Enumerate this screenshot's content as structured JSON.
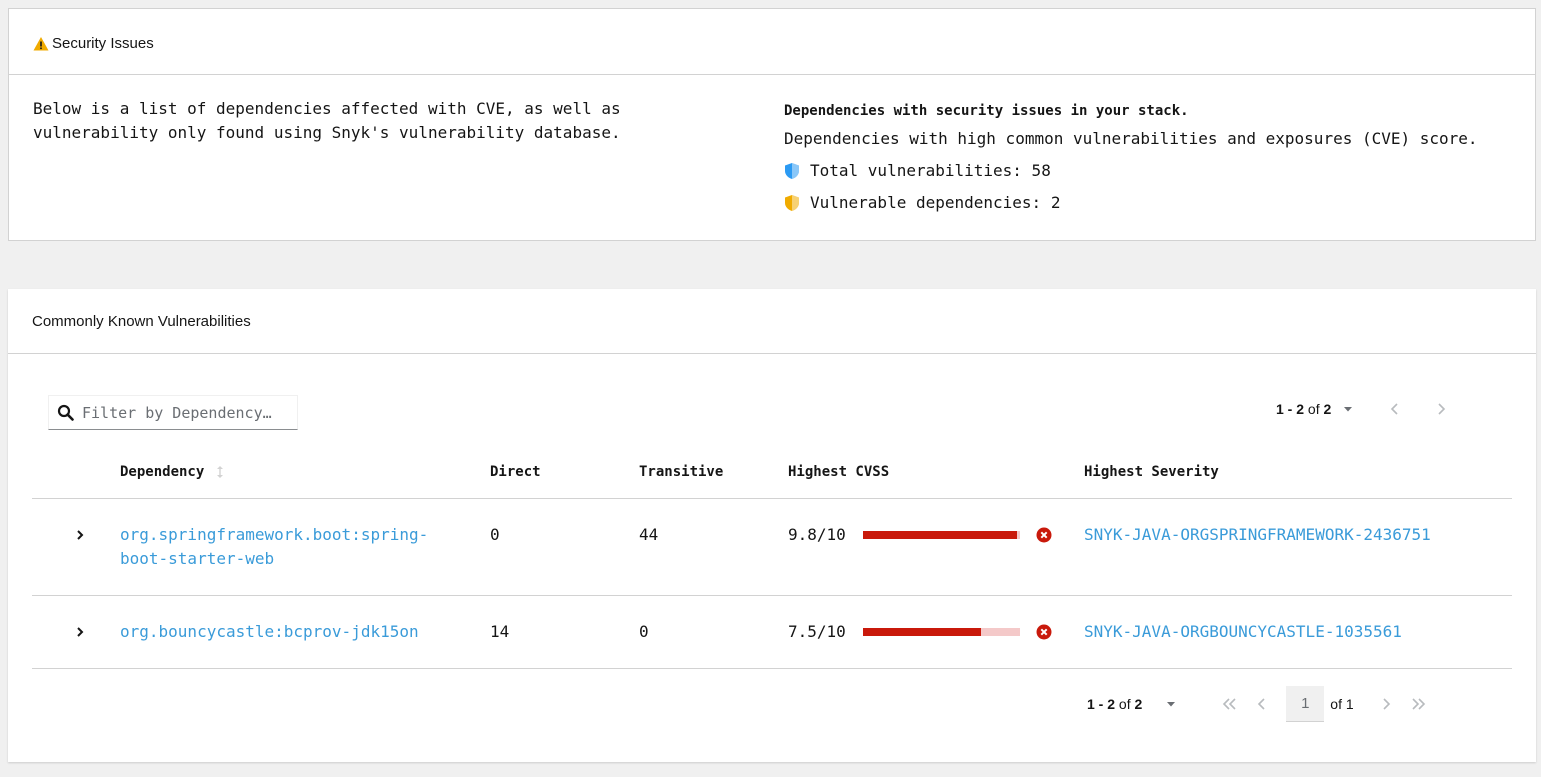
{
  "security_card": {
    "title": "Security Issues",
    "description": "Below is a list of dependencies affected with CVE, as well as vulnerability only found using Snyk's vulnerability database.",
    "stack_heading": "Dependencies with security issues in your stack.",
    "stack_sub": "Dependencies with high common vulnerabilities and exposures (CVE) score.",
    "total_vulnerabilities": "Total vulnerabilities: 58",
    "vulnerable_dependencies": "Vulnerable dependencies: 2",
    "colors": {
      "warning": "#f0ab00",
      "info_shield": "#2b9af3",
      "warn_shield": "#f0ab00"
    }
  },
  "vuln_card": {
    "title": "Commonly Known Vulnerabilities",
    "search": {
      "placeholder": "Filter by Dependency…"
    },
    "pager_top": {
      "range": "1 - 2",
      "of": "of",
      "total": "2"
    },
    "columns": {
      "dependency": "Dependency",
      "direct": "Direct",
      "transitive": "Transitive",
      "highest_cvss": "Highest CVSS",
      "highest_severity": "Highest Severity"
    },
    "rows": [
      {
        "dependency_line1": "org.springframework.boot:spring-",
        "dependency_line2": "boot-starter-web",
        "direct": "0",
        "transitive": "44",
        "cvss": "9.8/10",
        "cvss_fraction": 0.98,
        "severity": "SNYK-JAVA-ORGSPRINGFRAMEWORK-2436751"
      },
      {
        "dependency_line1": "org.bouncycastle:bcprov-jdk15on",
        "direct": "14",
        "transitive": "0",
        "cvss": "7.5/10",
        "cvss_fraction": 0.75,
        "severity": "SNYK-JAVA-ORGBOUNCYCASTLE-1035561"
      }
    ],
    "pager_bottom": {
      "range": "1 - 2",
      "of": "of",
      "total": "2",
      "page": "1",
      "page_of": "of 1"
    },
    "colors": {
      "link": "#3a9bd9",
      "danger": "#c9190b",
      "bar_track": "#f4c9c9"
    }
  }
}
